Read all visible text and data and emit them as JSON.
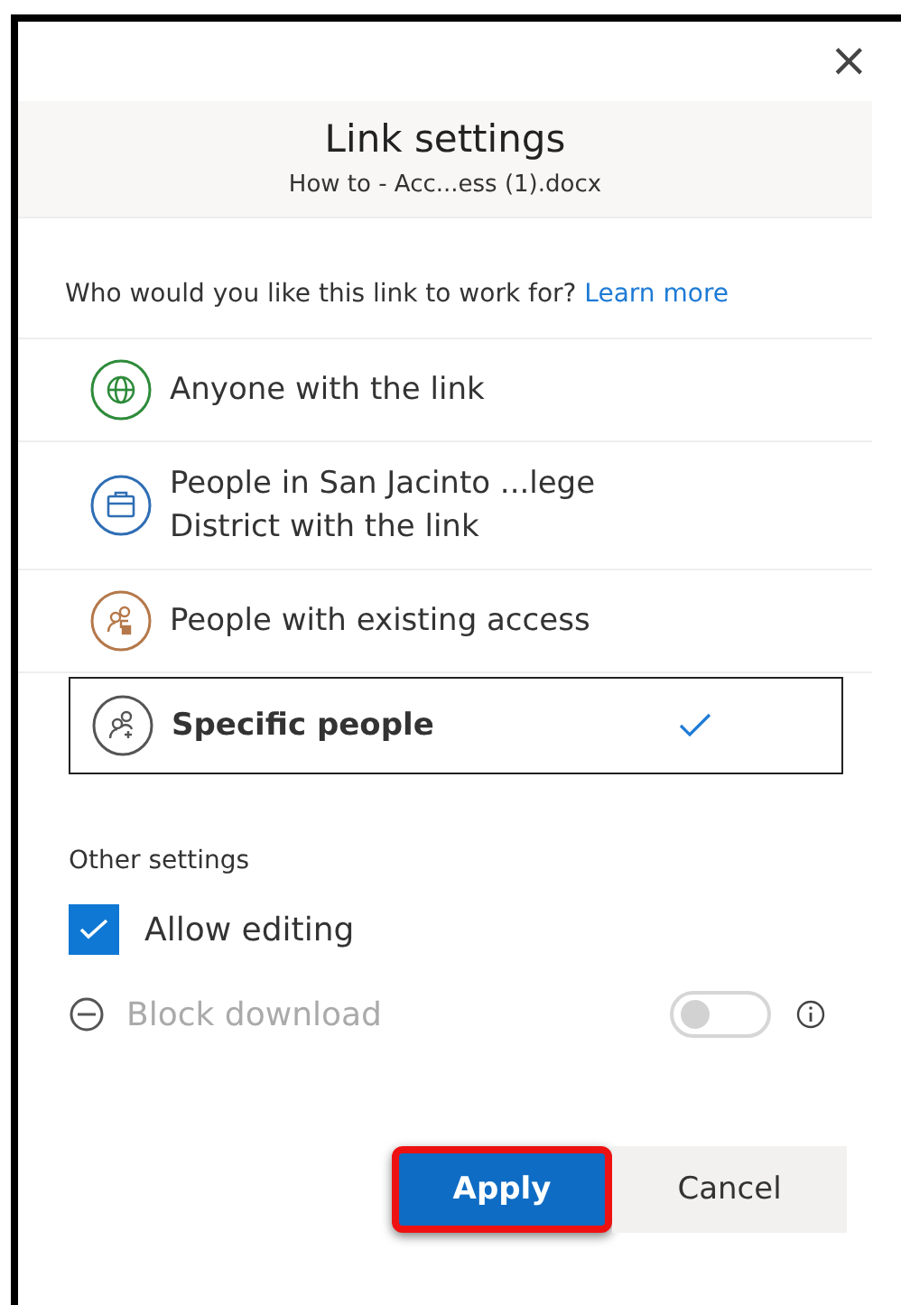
{
  "dialog": {
    "close": "×",
    "title": "Link settings",
    "subtitle": "How to - Acc...ess (1).docx"
  },
  "audience": {
    "question": "Who would you like this link to work for?",
    "link": "Learn more",
    "options": [
      {
        "kind": "globe",
        "color": "#2e8b3a",
        "label": "Anyone with the link",
        "selected": false
      },
      {
        "kind": "briefcase",
        "color": "#2f6eb5",
        "label": "People in San Jacinto ...lege District with the link",
        "selected": false
      },
      {
        "kind": "people-lock",
        "color": "#b5784a",
        "label": "People with existing access",
        "selected": false
      },
      {
        "kind": "people-add",
        "color": "#555555",
        "label": "Specific people",
        "selected": true
      }
    ]
  },
  "other_settings": {
    "heading": "Other settings",
    "allow_editing": {
      "label": "Allow editing",
      "checked": true
    },
    "block_download": {
      "label": "Block download",
      "on": false,
      "disabled": true
    }
  },
  "buttons": [
    {
      "kind": "primary",
      "label": "Apply",
      "highlighted": true
    },
    {
      "kind": "secondary",
      "label": "Cancel",
      "highlighted": false
    }
  ]
}
